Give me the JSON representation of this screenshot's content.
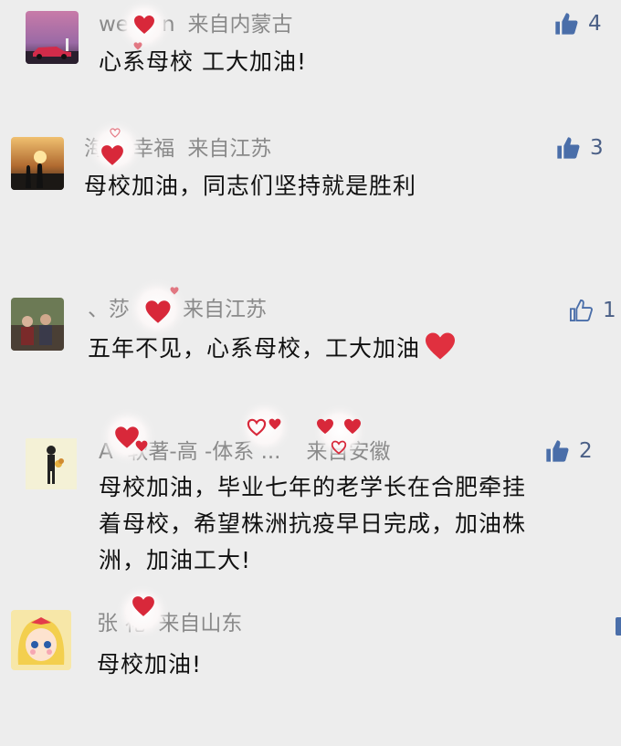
{
  "comments": [
    {
      "name_visible": "we   uan",
      "location": "来自内蒙古",
      "text": "心系母校 工大加油!",
      "likes": "4",
      "liked": false,
      "avatar": "car-sunset-avatar"
    },
    {
      "name_visible": "海   的幸福",
      "location": "来自江苏",
      "text": "母校加油，同志们坚持就是胜利",
      "likes": "3",
      "liked": false,
      "avatar": "couple-sunset-avatar"
    },
    {
      "name_visible": "、莎",
      "location": "来自江苏",
      "text": "五年不见，心系母校，工大加油",
      "likes": "1",
      "liked": true,
      "avatar": "group-photo-avatar"
    },
    {
      "name_visible": "A   -软著-高   -体系   ...",
      "location": "来自安徽",
      "text_lines": [
        "母校加油，毕业七年的老学长在合肥牵挂",
        "着母校，希望株洲抗疫早日完成，加油株",
        "洲，加油工大!"
      ],
      "likes": "2",
      "liked": false,
      "avatar": "figure-with-bouquet-avatar"
    },
    {
      "name_visible": "张   花",
      "location": "来自山东",
      "text": "母校加油!",
      "likes": "",
      "liked": false,
      "avatar": "anime-girl-avatar"
    }
  ],
  "colors": {
    "background": "#ededed",
    "name": "#8a8a8a",
    "text": "#111111",
    "like_icon": "#4a6ea9",
    "heart_red": "#e0303f"
  }
}
